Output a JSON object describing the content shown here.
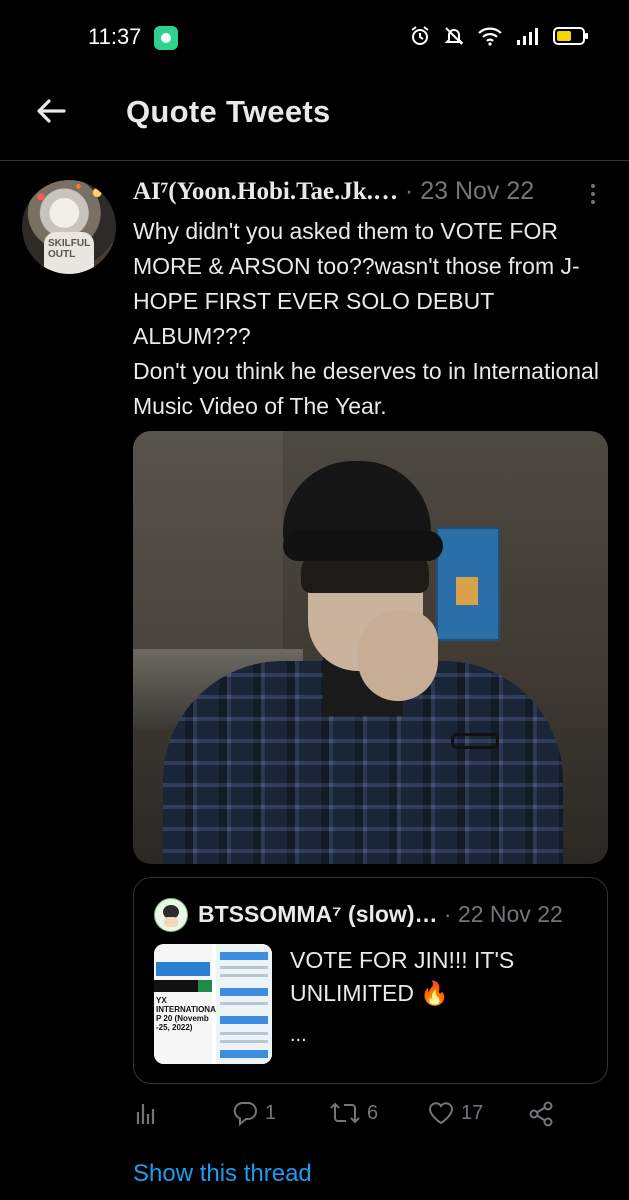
{
  "status_bar": {
    "time": "11:37",
    "icons": [
      "app-notification-icon",
      "alarm-icon",
      "mute-icon",
      "wifi-icon",
      "signal-icon",
      "battery-icon"
    ]
  },
  "header": {
    "title": "Quote Tweets",
    "back_icon": "arrow-left-icon"
  },
  "tweet": {
    "author": "AI⁷(Yoon.Hobi.Tae.Jk.…",
    "separator": "·",
    "date": "23 Nov 22",
    "body_lines": [
      "Why didn't you asked them to VOTE FOR MORE & ARSON too??wasn't those from J-HOPE FIRST EVER SOLO DEBUT ALBUM???",
      "Don't you think he deserves to in International Music Video of The Year."
    ],
    "avatar_text": "SKILFUL OUTL",
    "quoted": {
      "author": "BTSSOMMA⁷ (slow)…",
      "separator": "·",
      "date": "22 Nov 22",
      "text_lines": [
        "VOTE FOR JIN!!! IT'S",
        "UNLIMITED 🔥"
      ],
      "ellipsis": "...",
      "thumb_text": "YX INTERNATIONAL P 20 (Novemb -25, 2022)"
    },
    "actions": {
      "analytics_icon": "analytics-icon",
      "replies": "1",
      "retweets": "6",
      "likes": "17",
      "share_icon": "share-icon"
    },
    "show_thread": "Show this thread"
  },
  "colors": {
    "background": "#000000",
    "text": "#e7e9ea",
    "muted": "#71767b",
    "link": "#1d9bf0",
    "divider": "#2f3336"
  }
}
